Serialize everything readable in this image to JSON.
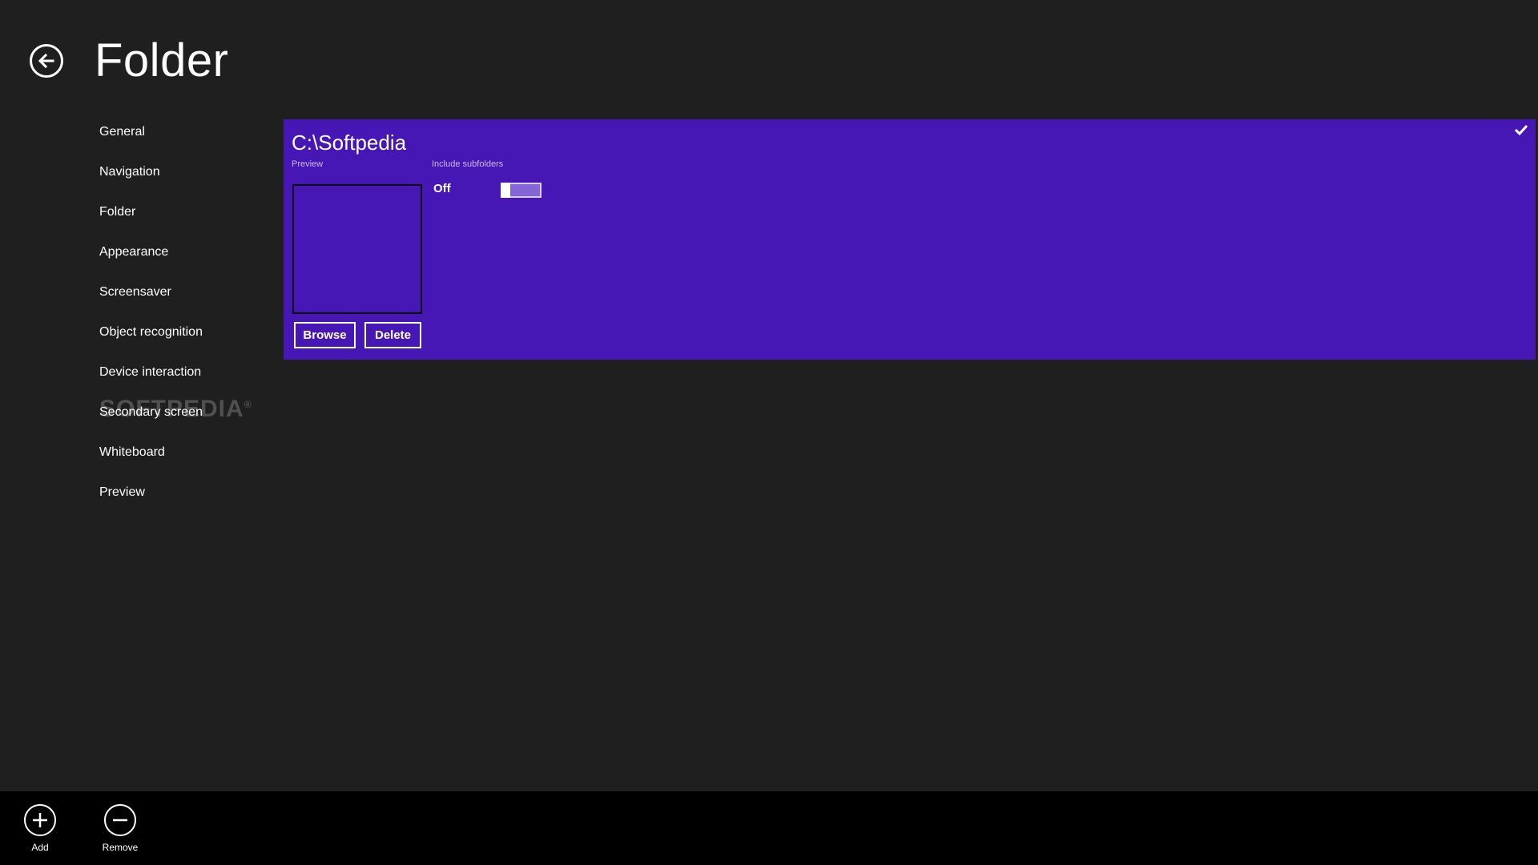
{
  "header": {
    "title": "Folder",
    "back_icon": "back-arrow-icon"
  },
  "sidebar": {
    "items": [
      {
        "label": "General"
      },
      {
        "label": "Navigation"
      },
      {
        "label": "Folder"
      },
      {
        "label": "Appearance"
      },
      {
        "label": "Screensaver"
      },
      {
        "label": "Object recognition"
      },
      {
        "label": "Device interaction"
      },
      {
        "label": "Secondary screen"
      },
      {
        "label": "Whiteboard"
      },
      {
        "label": "Preview"
      }
    ]
  },
  "watermark": {
    "text": "SOFTPEDIA",
    "mark": "®"
  },
  "folder_card": {
    "path": "C:\\Softpedia",
    "preview_label": "Preview",
    "subfolders_label": "Include subfolders",
    "toggle_state": "Off",
    "toggle_on": false,
    "browse_label": "Browse",
    "delete_label": "Delete",
    "selected_icon": "checkmark-icon",
    "accent_color": "#4617b4"
  },
  "app_bar": {
    "add_label": "Add",
    "remove_label": "Remove",
    "add_icon": "add-circle-icon",
    "remove_icon": "remove-circle-icon"
  },
  "colors": {
    "background": "#1f1f1f",
    "app_bar": "#000000",
    "accent": "#4617b4"
  }
}
